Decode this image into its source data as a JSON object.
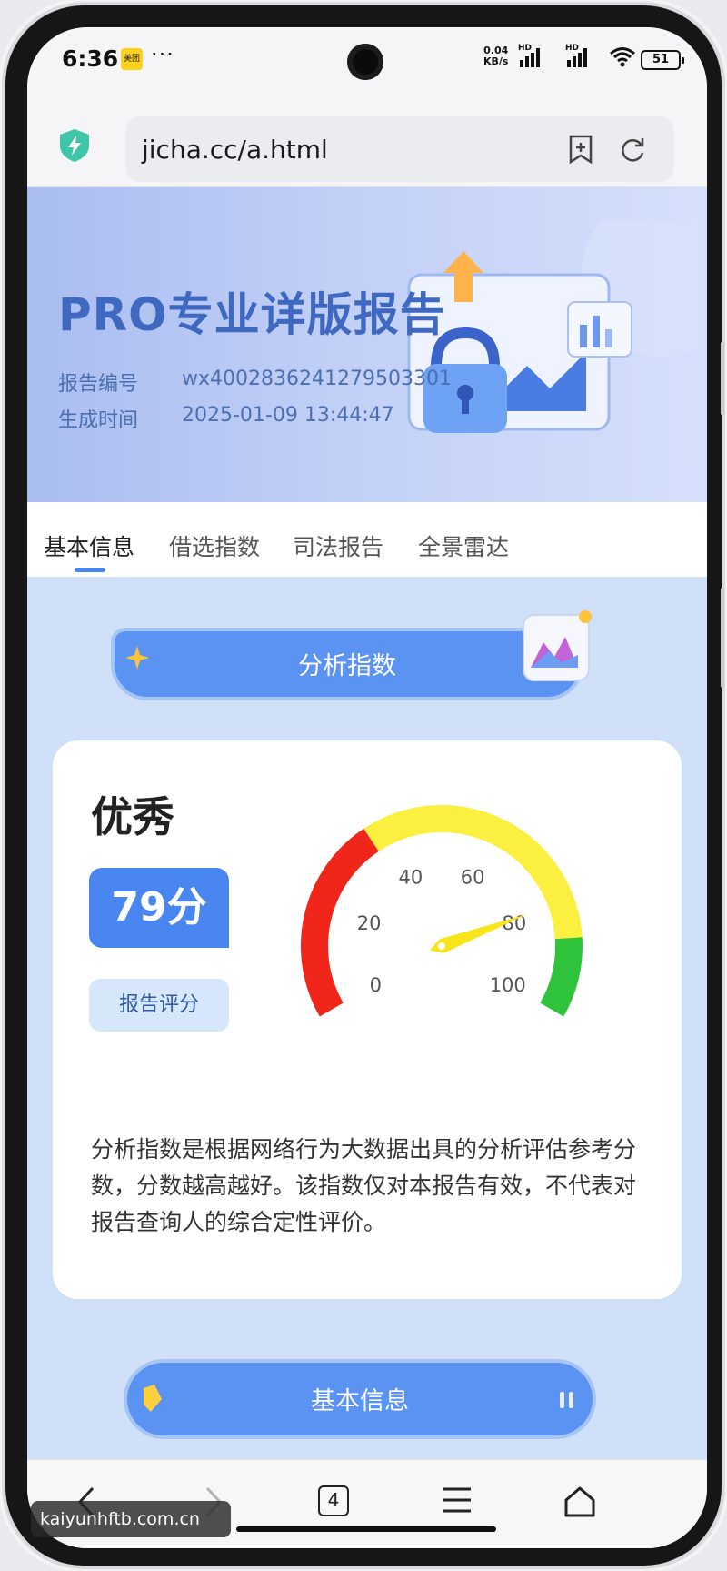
{
  "status_bar": {
    "time": "6:36",
    "app_badge": "美团",
    "more": "···",
    "net_speed_value": "0.04",
    "net_speed_unit": "KB/s",
    "sig1_label": "HD",
    "sig2_label": "HD",
    "battery": "51"
  },
  "browser": {
    "url": "jicha.cc/a.html"
  },
  "banner": {
    "title": "PRO专业详版报告",
    "report_no_label": "报告编号",
    "report_no": "wx4002836241279503301",
    "time_label": "生成时间",
    "time": "2025-01-09 13:44:47"
  },
  "tabs": [
    "基本信息",
    "借选指数",
    "司法报告",
    "全景雷达"
  ],
  "active_tab": 0,
  "section_analysis": {
    "title": "分析指数"
  },
  "score_card": {
    "grade": "优秀",
    "score": "79分",
    "score_label": "报告评分",
    "gauge_value": 79,
    "gauge_ticks": [
      "0",
      "20",
      "40",
      "60",
      "80",
      "100"
    ],
    "gauge_colors": {
      "low": "#f0261a",
      "mid": "#fbf03f",
      "high": "#2fc23b",
      "needle": "#f7e51a"
    },
    "description": "分析指数是根据网络行为大数据出具的分析评估参考分数，分数越高越好。该指数仅对本报告有效，不代表对报告查询人的综合定性评价。"
  },
  "section_basic": {
    "title": "基本信息"
  },
  "bottom_nav": {
    "tab_count": "4",
    "items": [
      "back-icon",
      "forward-icon",
      "tabs-icon",
      "menu-icon",
      "home-icon"
    ]
  },
  "watermark": "kaiyunhftb.com.cn",
  "colors": {
    "accent": "#4a86ef",
    "banner_text": "#3f68c0",
    "page_bg": "#cfe0f8"
  }
}
